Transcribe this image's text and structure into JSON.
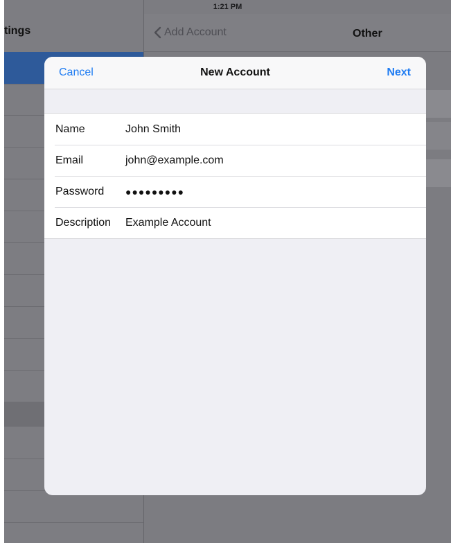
{
  "status": {
    "time": "1:21 PM"
  },
  "left_pane": {
    "title": "tings"
  },
  "right_pane": {
    "back_label": "Add Account",
    "title": "Other"
  },
  "modal": {
    "cancel_label": "Cancel",
    "title": "New Account",
    "next_label": "Next",
    "fields": [
      {
        "label": "Name",
        "value": "John Smith"
      },
      {
        "label": "Email",
        "value": "john@example.com"
      },
      {
        "label": "Password",
        "value": "●●●●●●●●●"
      },
      {
        "label": "Description",
        "value": "Example Account"
      }
    ]
  },
  "colors": {
    "accent": "#1f7cf2",
    "selected_row": "#2e5a9a"
  }
}
